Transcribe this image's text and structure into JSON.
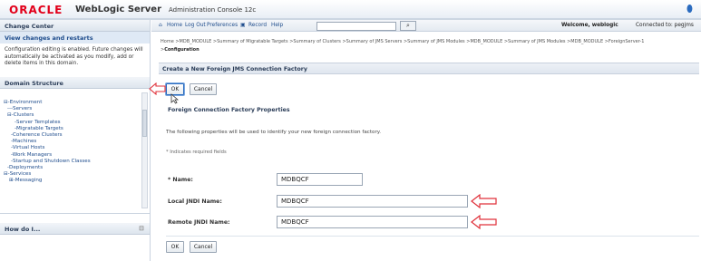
{
  "banner": {
    "brand": "ORACLE",
    "product": "WebLogic Server",
    "subtitle": "Administration Console 12c"
  },
  "change_center": {
    "heading": "Change Center",
    "link": "View changes and restarts",
    "text": "Configuration editing is enabled. Future changes will automatically be activated as you modify, add or delete items in this domain."
  },
  "domain_structure": {
    "heading": "Domain Structure",
    "tree": [
      "⊟-Environment",
      "---Servers",
      "⊟-Clusters",
      "-Server Templates",
      "-Migratable Targets",
      "-Coherence Clusters",
      "-Machines",
      "-Virtual Hosts",
      "-Work Managers",
      "-Startup and Shutdown Classes",
      "-Deployments",
      "⊟-Services",
      "⊞-Messaging"
    ]
  },
  "how_do_i": {
    "heading": "How do I...",
    "toggle": "⊟"
  },
  "toolbar": {
    "home": "Home",
    "logout": "Log Out",
    "preferences": "Preferences",
    "record": "Record",
    "help": "Help",
    "search_value": "",
    "welcome": "Welcome, weblogic",
    "connected": "Connected to: pegjms"
  },
  "breadcrumb": {
    "text": "Home >MDB_MODULE >Summary of Migratable Targets >Summary of Clusters >Summary of JMS Servers >Summary of JMS Modules >MDB_MODULE >Summary of JMS Modules >MDB_MODULE >ForeignServer-1 >",
    "current": "Configuration"
  },
  "form": {
    "title": "Create a New Foreign JMS Connection Factory",
    "ok_label": "OK",
    "cancel_label": "Cancel",
    "section_title": "Foreign Connection Factory Properties",
    "description": "The following properties will be used to identify your new foreign connection factory.",
    "required_note": "* Indicates required fields",
    "name_label": "* Name:",
    "name_value": "MDBQCF",
    "local_label": "Local JNDI Name:",
    "local_value": "MDBQCF",
    "remote_label": "Remote JNDI Name:",
    "remote_value": "MDBQCF"
  },
  "colors": {
    "brand_red": "#e2001a",
    "arrow_red": "#e0303a",
    "link_blue": "#1e4c8c"
  }
}
